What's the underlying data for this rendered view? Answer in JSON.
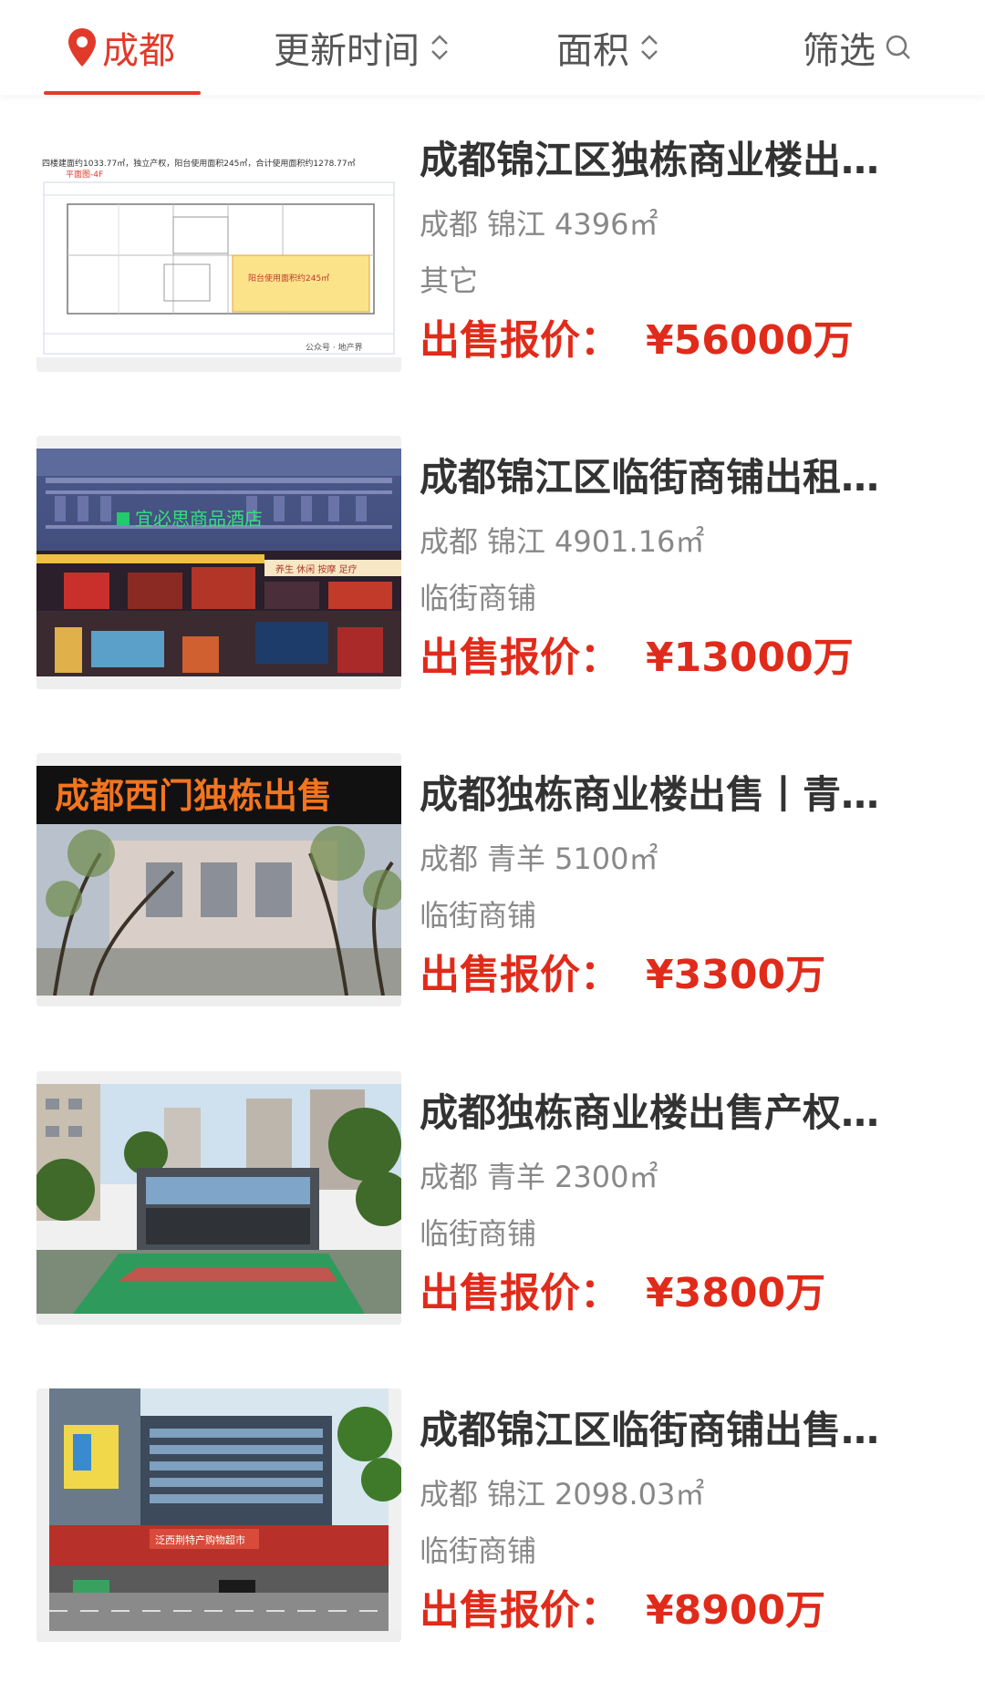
{
  "filters": {
    "city": "成都",
    "update_time": "更新时间",
    "area": "面积",
    "screen": "筛选"
  },
  "colors": {
    "accent": "#e23a2a",
    "price": "#e02b1b",
    "title": "#333333",
    "secondary": "#888888"
  },
  "listings": [
    {
      "title": "成都锦江区独栋商业楼出…",
      "city": "成都",
      "district": "锦江",
      "size": "4396㎡",
      "category": "其它",
      "price_label": "出售报价：",
      "price": "¥56000万",
      "thumb_texts": {
        "line1": "四楼建面约1033.77㎡，独立产权，阳台使用面积245㎡，合计使用面积约1278.77㎡",
        "line2": "平面图-4F",
        "highlight": "阳台使用面积约245㎡",
        "watermark": "公众号 · 地产界"
      }
    },
    {
      "title": "成都锦江区临街商铺出租…",
      "city": "成都",
      "district": "锦江",
      "size": "4901.16㎡",
      "category": "临街商铺",
      "price_label": "出售报价：",
      "price": "¥13000万",
      "thumb_texts": {
        "sign": "宜必思商品酒店",
        "shops": "养生 休闲 按摩 足疗"
      }
    },
    {
      "title": "成都独栋商业楼出售丨青…",
      "city": "成都",
      "district": "青羊",
      "size": "5100㎡",
      "category": "临街商铺",
      "price_label": "出售报价：",
      "price": "¥3300万",
      "thumb_texts": {
        "banner": "成都西门独栋出售"
      }
    },
    {
      "title": "成都独栋商业楼出售产权…",
      "city": "成都",
      "district": "青羊",
      "size": "2300㎡",
      "category": "临街商铺",
      "price_label": "出售报价：",
      "price": "¥3800万",
      "thumb_texts": {}
    },
    {
      "title": "成都锦江区临街商铺出售…",
      "city": "成都",
      "district": "锦江",
      "size": "2098.03㎡",
      "category": "临街商铺",
      "price_label": "出售报价：",
      "price": "¥8900万",
      "thumb_texts": {
        "shop": "泛西荆特产购物超市"
      }
    }
  ]
}
